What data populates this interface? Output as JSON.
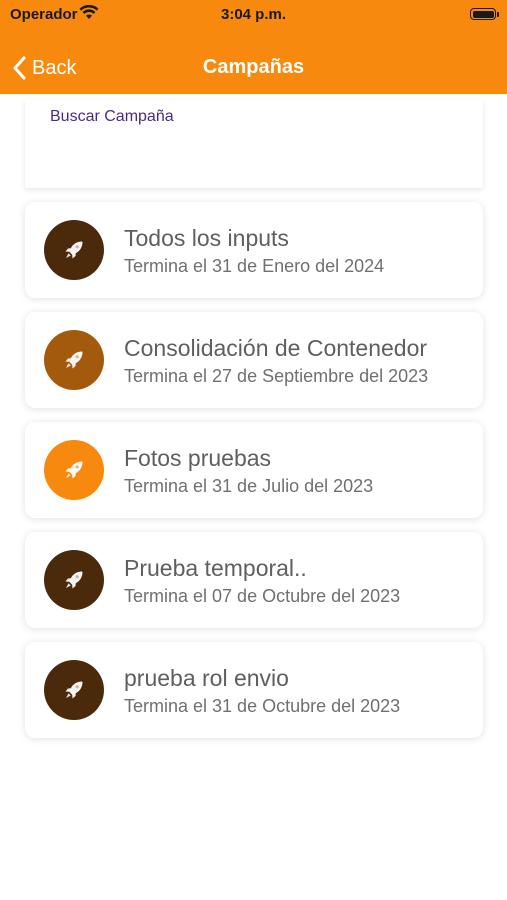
{
  "status_bar": {
    "carrier": "Operador",
    "time": "3:04 p.m."
  },
  "nav": {
    "back_label": "Back",
    "title": "Campañas"
  },
  "search": {
    "placeholder": "Buscar Campaña"
  },
  "colors": {
    "brand": "#f7890e",
    "dark": "#4a2a0a",
    "medium": "#a45a0d",
    "light": "#f7890e"
  },
  "campaigns": [
    {
      "title": "Todos los inputs",
      "subtitle": "Termina el 31 de Enero del 2024",
      "icon": "rocket-icon",
      "color": "#4a2a0a"
    },
    {
      "title": "Consolidación de Contenedor",
      "subtitle": "Termina el 27 de Septiembre del 2023",
      "icon": "rocket-icon",
      "color": "#a45a0d"
    },
    {
      "title": "Fotos pruebas",
      "subtitle": "Termina el 31 de Julio del 2023",
      "icon": "rocket-icon",
      "color": "#f7890e"
    },
    {
      "title": "Prueba temporal..",
      "subtitle": "Termina el 07 de Octubre del 2023",
      "icon": "rocket-icon",
      "color": "#4a2a0a"
    },
    {
      "title": "prueba rol envio",
      "subtitle": "Termina el 31 de Octubre del 2023",
      "icon": "rocket-icon",
      "color": "#4a2a0a"
    }
  ]
}
